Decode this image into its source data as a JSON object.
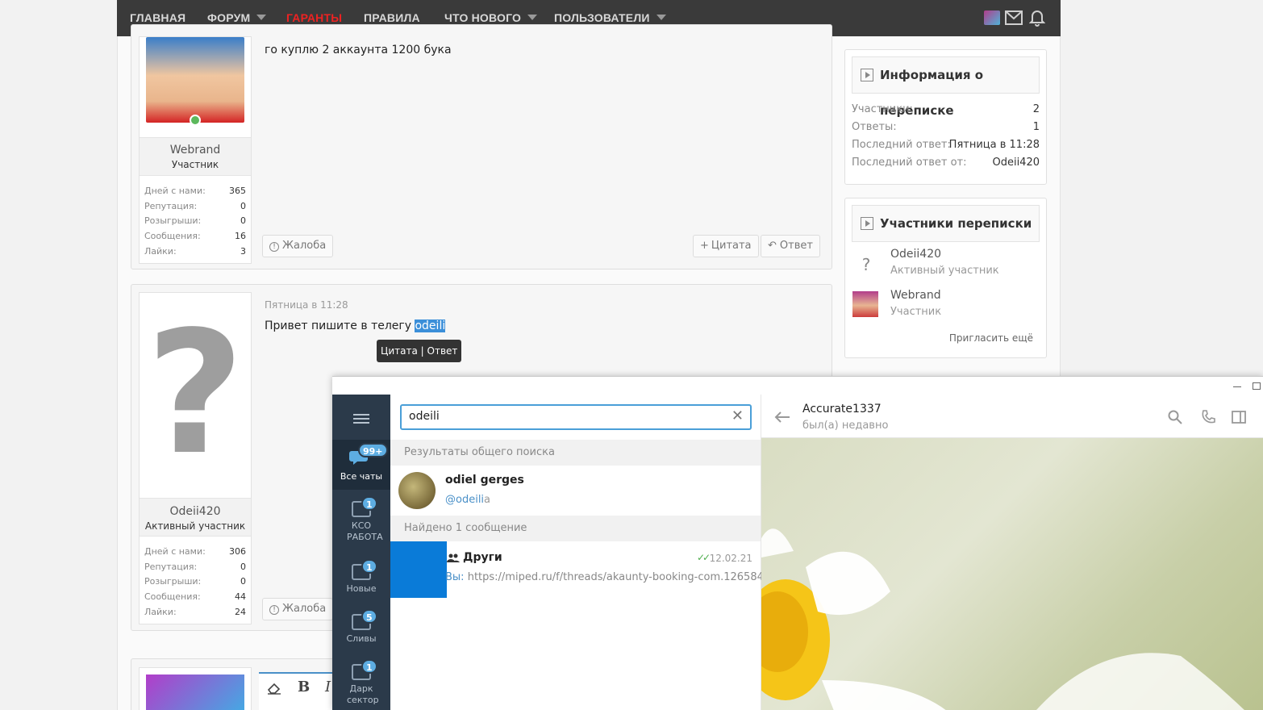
{
  "nav": {
    "items": [
      {
        "label": "ГЛАВНАЯ",
        "dropdown": false,
        "highlight": false
      },
      {
        "label": "ФОРУМ",
        "dropdown": true,
        "highlight": false
      },
      {
        "label": "ГАРАНТЫ",
        "dropdown": false,
        "highlight": true
      },
      {
        "label": "ПРАВИЛА",
        "dropdown": false,
        "highlight": false
      },
      {
        "label": "ЧТО НОВОГО",
        "dropdown": true,
        "highlight": false
      },
      {
        "label": "ПОЛЬЗОВАТЕЛИ",
        "dropdown": true,
        "highlight": false
      }
    ],
    "highlight_color": "#ee2222"
  },
  "posts": [
    {
      "message": "го куплю 2 аккаунта 1200 бука",
      "user": {
        "name": "Webrand",
        "role": "Участник"
      },
      "stats": [
        {
          "label": "Дней с нами:",
          "value": "365"
        },
        {
          "label": "Репутация:",
          "value": "0"
        },
        {
          "label": "Розыгрыши:",
          "value": "0"
        },
        {
          "label": "Сообщения:",
          "value": "16"
        },
        {
          "label": "Лайки:",
          "value": "3"
        }
      ],
      "report_label": "Жалоба",
      "quote_label": "Цитата",
      "reply_label": "Ответ"
    },
    {
      "date": "Пятница в 11:28",
      "message_prefix": "Привет пишите в телегу ",
      "message_selected": "odeili",
      "user": {
        "name": "Odeii420",
        "role": "Активный участник"
      },
      "stats": [
        {
          "label": "Дней с нами:",
          "value": "306"
        },
        {
          "label": "Репутация:",
          "value": "0"
        },
        {
          "label": "Розыгрыши:",
          "value": "0"
        },
        {
          "label": "Сообщения:",
          "value": "44"
        },
        {
          "label": "Лайки:",
          "value": "24"
        }
      ],
      "report_label": "Жалоба",
      "tooltip": {
        "quote": "Цитата",
        "sep": "|",
        "reply": "Ответ"
      }
    }
  ],
  "sidebar": {
    "info": {
      "title": "Информация о переписке",
      "rows": [
        {
          "label": "Участники:",
          "value": "2"
        },
        {
          "label": "Ответы:",
          "value": "1"
        },
        {
          "label": "Последний ответ:",
          "value": "Пятница в 11:28"
        },
        {
          "label": "Последний ответ от:",
          "value": "Odeii420"
        }
      ]
    },
    "members": {
      "title": "Участники переписки",
      "list": [
        {
          "name": "Odeii420",
          "role": "Активный участник"
        },
        {
          "name": "Webrand",
          "role": "Участник"
        }
      ],
      "invite_label": "Пригласить ещё"
    }
  },
  "telegram": {
    "folders": [
      {
        "label": "Все чаты",
        "badge": "99+",
        "active": true
      },
      {
        "label": "КСО РАБОТА",
        "badge": "1",
        "active": false
      },
      {
        "label": "Новые",
        "badge": "1",
        "active": false
      },
      {
        "label": "Сливы",
        "badge": "5",
        "active": false
      },
      {
        "label": "Дарк сектор",
        "badge": "1",
        "active": false
      }
    ],
    "search": {
      "value": "odeili"
    },
    "global_section": "Результаты общего поиска",
    "global_result": {
      "name": "odiel gerges",
      "handle_prefix": "@odeili",
      "handle_suffix": "a"
    },
    "messages_section": "Найдено 1 сообщение",
    "message_result": {
      "chat": "Други",
      "date": "12.02.21",
      "sender": "Вы:",
      "text": "https://miped.ru/f/threads/akaunty-booking-com.126584/"
    },
    "chat": {
      "name": "Accurate1337",
      "status": "был(а) недавно"
    },
    "accent": "#4a90c8"
  }
}
